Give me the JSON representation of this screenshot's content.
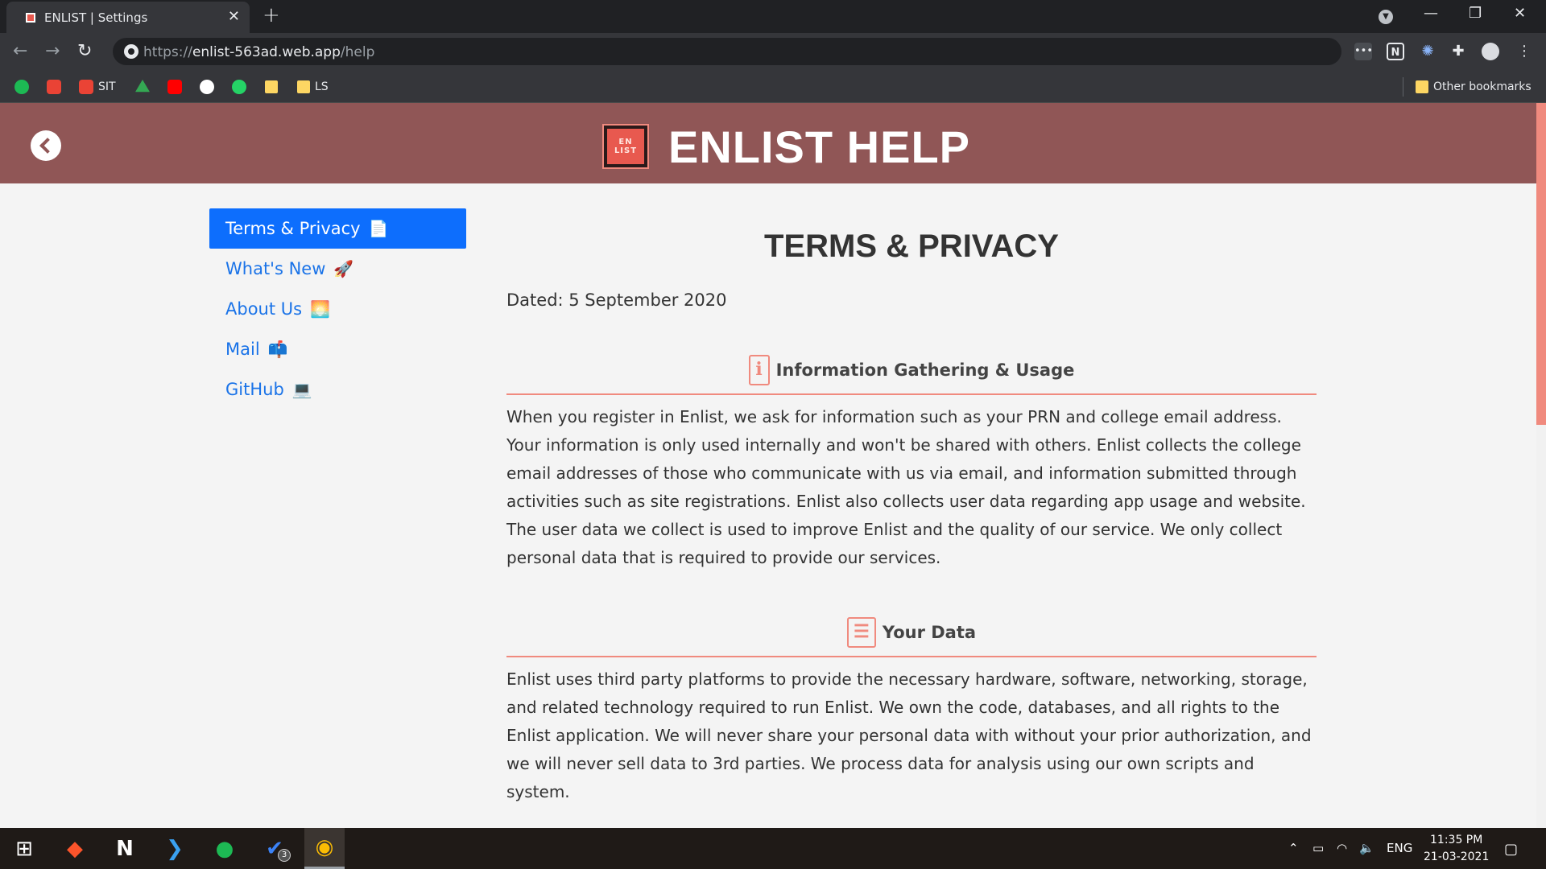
{
  "browser": {
    "tab_title": "ENLIST | Settings",
    "tab_close": "✕",
    "new_tab": "+",
    "url_scheme": "https://",
    "url_host": "enlist-563ad.web.app",
    "url_path": "/help",
    "window_controls": {
      "minimize": "—",
      "maximize": "❐",
      "close": "✕"
    },
    "bookmarks": [
      {
        "label": "",
        "icon": "spotify-icon",
        "color": "#1DB954"
      },
      {
        "label": "",
        "icon": "gmail-icon",
        "color": "#EA4335"
      },
      {
        "label": "SIT",
        "icon": "gmail-icon",
        "color": "#EA4335"
      },
      {
        "label": "",
        "icon": "google-drive-icon",
        "color": "#34A853"
      },
      {
        "label": "",
        "icon": "youtube-icon",
        "color": "#FF0000"
      },
      {
        "label": "",
        "icon": "github-icon",
        "color": "#FFFFFF"
      },
      {
        "label": "",
        "icon": "whatsapp-icon",
        "color": "#25D366"
      },
      {
        "label": "",
        "icon": "folder-icon",
        "color": "#FDD663"
      },
      {
        "label": "LS",
        "icon": "folder-icon",
        "color": "#FDD663"
      }
    ],
    "other_bookmarks": "Other bookmarks"
  },
  "header": {
    "logo_line1": "EN",
    "logo_line2": "LIST",
    "title": "ENLIST HELP"
  },
  "sidebar": {
    "items": [
      {
        "label": "Terms & Privacy",
        "emoji": "📄",
        "active": true
      },
      {
        "label": "What's New",
        "emoji": "🚀",
        "active": false
      },
      {
        "label": "About Us",
        "emoji": "🌅",
        "active": false
      },
      {
        "label": "Mail",
        "emoji": "📫",
        "active": false
      },
      {
        "label": "GitHub",
        "emoji": "💻",
        "active": false
      }
    ]
  },
  "content": {
    "title": "TERMS & PRIVACY",
    "dated": "Dated: 5 September 2020",
    "sections": [
      {
        "icon": "info-icon",
        "icon_glyph": "i",
        "title": "Information Gathering & Usage",
        "body": "When you register in Enlist, we ask for information such as your PRN and college email address. Your information is only used internally and won't be shared with others. Enlist collects the college email addresses of those who communicate with us via email, and information submitted through activities such as site registrations. Enlist also collects user data regarding app usage and website. The user data we collect is used to improve Enlist and the quality of our service. We only collect personal data that is required to provide our services."
      },
      {
        "icon": "database-icon",
        "icon_glyph": "☰",
        "title": "Your Data",
        "body": "Enlist uses third party platforms to provide the necessary hardware, software, networking, storage, and related technology required to run Enlist. We own the code, databases, and all rights to the Enlist application. We will never share your personal data with without your prior authorization, and we will never sell data to 3rd parties. We process data for analysis using our own scripts and system."
      }
    ]
  },
  "colors": {
    "header_bg": "#905656",
    "accent": "#F08A7E",
    "active_nav": "#0D6EFD",
    "link": "#1A73E8"
  },
  "taskbar": {
    "badge_count": "3",
    "language": "ENG",
    "time": "11:35 PM",
    "date": "21-03-2021"
  }
}
